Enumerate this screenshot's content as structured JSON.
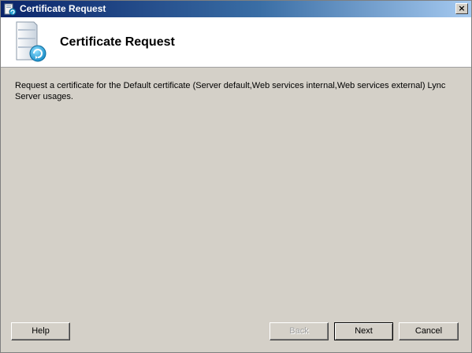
{
  "window": {
    "title": "Certificate Request",
    "close_label": "×"
  },
  "header": {
    "title": "Certificate Request"
  },
  "body": {
    "description": "Request a certificate for the Default certificate (Server default,Web services internal,Web services external) Lync Server usages."
  },
  "buttons": {
    "help": "Help",
    "back": "Back",
    "next": "Next",
    "cancel": "Cancel"
  },
  "icons": {
    "title": "certificate-request-icon",
    "header": "server-refresh-icon"
  },
  "colors": {
    "titlebar_start": "#0a246a",
    "titlebar_end": "#a6caf0",
    "dialog_background": "#d4d0c8",
    "header_background": "#ffffff"
  }
}
